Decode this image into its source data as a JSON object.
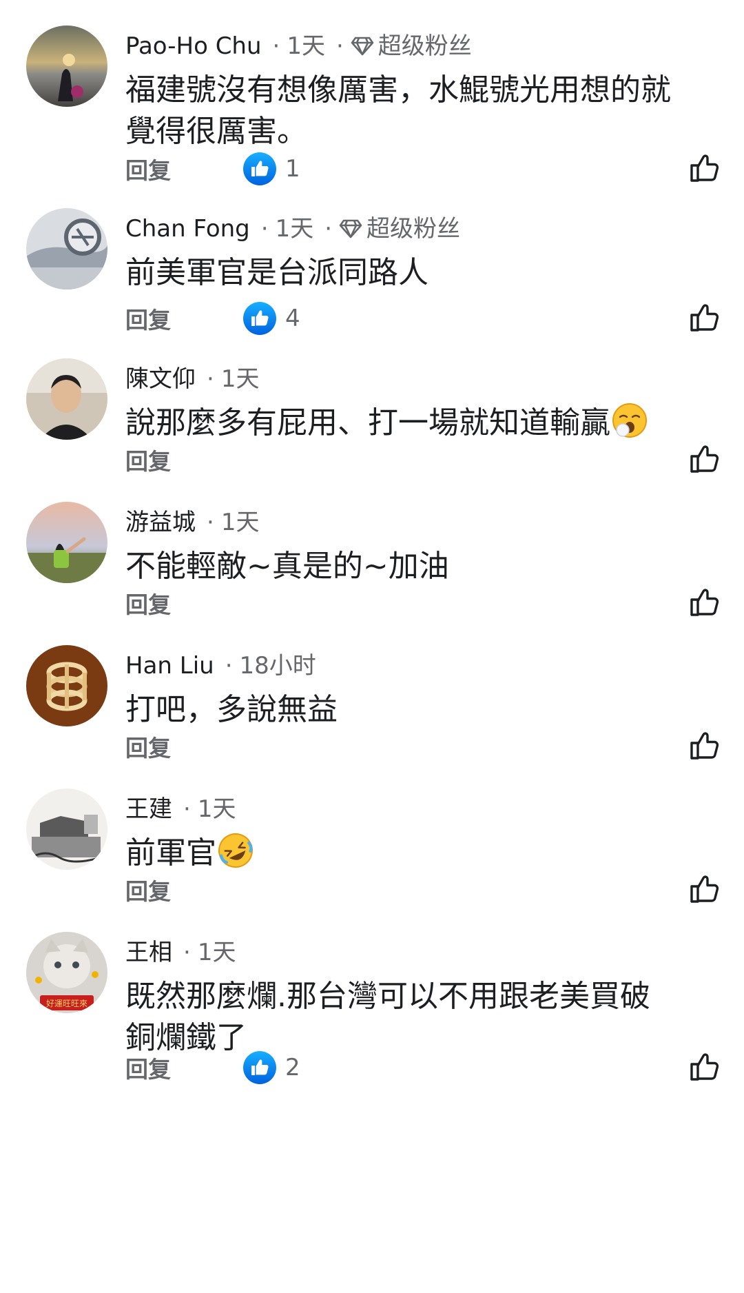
{
  "badge_label": "超级粉丝",
  "reply_label": "回复",
  "like_icon": "thumb-up-outline-icon",
  "reaction_icon": "thumb-up-filled-blue-icon",
  "comments": [
    {
      "author": "Pao-Ho Chu",
      "time": "1天",
      "badge": true,
      "line1": "福建號沒有想像厲害，水鯤號光用想的就",
      "line2": "覺得很厲害。",
      "reactions": "1"
    },
    {
      "author": "Chan Fong",
      "time": "1天",
      "badge": true,
      "line1": "前美軍官是台派同路人",
      "line2": "",
      "reactions": "4"
    },
    {
      "author": "陳文仰",
      "time": "1天",
      "badge": false,
      "line1": "說那麼多有屁用、打一場就知道輸贏",
      "line2": "",
      "emoji": "yawning-face-emoji",
      "reactions": ""
    },
    {
      "author": "游益城",
      "time": "1天",
      "badge": false,
      "line1": "不能輕敵~真是的~加油",
      "line2": "",
      "reactions": ""
    },
    {
      "author": "Han Liu",
      "time": "18小时",
      "badge": false,
      "line1": "打吧，多說無益",
      "line2": "",
      "reactions": ""
    },
    {
      "author": "王建",
      "time": "1天",
      "badge": false,
      "line1": "前軍官",
      "line2": "",
      "emoji": "rolling-laughing-emoji",
      "reactions": ""
    },
    {
      "author": "王相",
      "time": "1天",
      "badge": false,
      "line1": "既然那麼爛.那台灣可以不用跟老美買破",
      "line2": "銅爛鐵了",
      "reactions": "2",
      "avatar_text": "好運旺旺來"
    }
  ],
  "colors": {
    "text": "#1c1e21",
    "secondary": "#65676b",
    "reaction_blue": "#1877f2"
  }
}
